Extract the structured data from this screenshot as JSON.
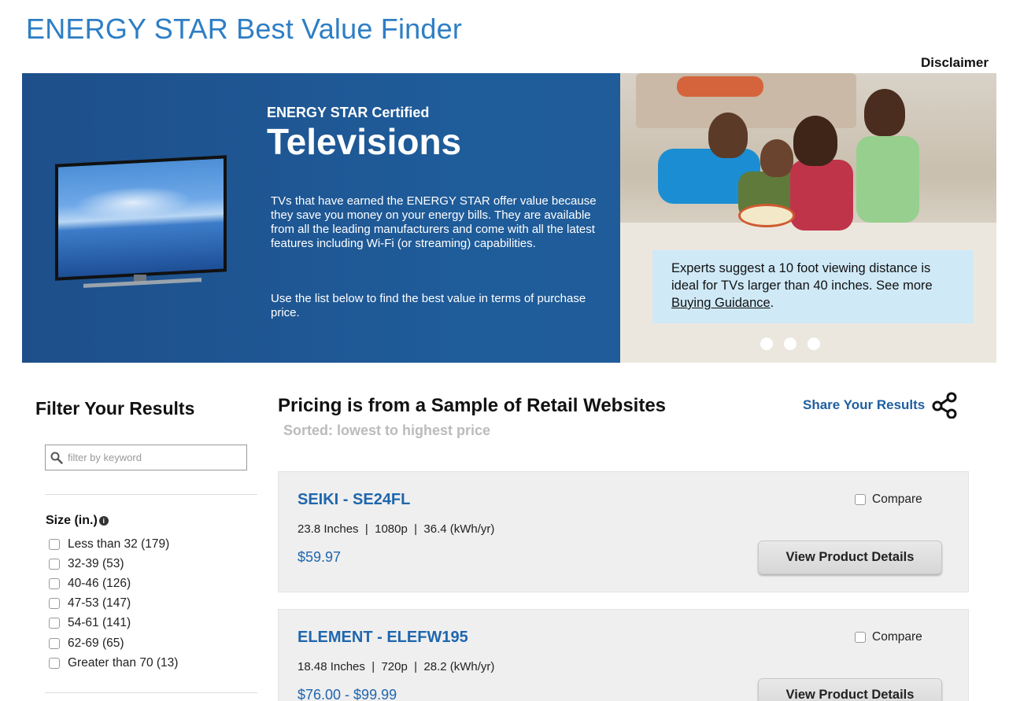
{
  "page": {
    "title": "ENERGY STAR Best Value Finder",
    "disclaimer_link": "Disclaimer"
  },
  "hero": {
    "subtitle": "ENERGY STAR Certified",
    "title": "Televisions",
    "description": "TVs that have earned the ENERGY STAR offer value because they save you money on your energy bills. They are available from all the leading manufacturers and come with all the latest features including Wi-Fi (or streaming) capabilities.",
    "instruction": "Use the list below to find the best value in terms of purchase price.",
    "tip_text": "Experts suggest a 10 foot viewing distance is ideal for TVs larger than 40 inches. See more",
    "tip_link": "Buying Guidance",
    "tip_end": ".",
    "carousel_dots": 3
  },
  "sidebar": {
    "title": "Filter Your Results",
    "search_placeholder": "filter by keyword",
    "size_heading": "Size (in.)",
    "size_options": [
      {
        "label": "Less than 32 (179)"
      },
      {
        "label": "32-39 (53)"
      },
      {
        "label": "40-46 (126)"
      },
      {
        "label": "47-53 (147)"
      },
      {
        "label": "54-61 (141)"
      },
      {
        "label": "62-69 (65)"
      },
      {
        "label": "Greater than 70 (13)"
      }
    ]
  },
  "results": {
    "title": "Pricing is from a Sample of Retail Websites",
    "sorted": "Sorted: lowest to highest price",
    "share_label": "Share Your Results",
    "compare_label": "Compare",
    "details_button": "View Product Details",
    "products": [
      {
        "name": "SEIKI - SE24FL",
        "specs": "23.8 Inches  |  1080p  |  36.4 (kWh/yr)",
        "price": "$59.97"
      },
      {
        "name": "ELEMENT - ELEFW195",
        "specs": "18.48 Inches  |  720p  |  28.2 (kWh/yr)",
        "price": "$76.00 - $99.99"
      }
    ]
  }
}
